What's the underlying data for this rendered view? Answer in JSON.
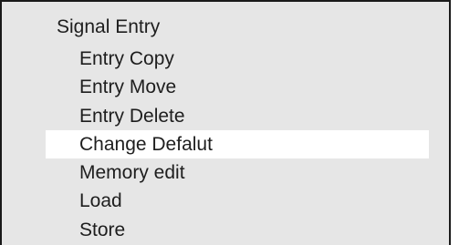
{
  "menu": {
    "title": "Signal Entry",
    "items": [
      {
        "label": "Entry Copy",
        "selected": false
      },
      {
        "label": "Entry Move",
        "selected": false
      },
      {
        "label": "Entry Delete",
        "selected": false
      },
      {
        "label": "Change Defalut",
        "selected": true
      },
      {
        "label": "Memory edit",
        "selected": false
      },
      {
        "label": "Load",
        "selected": false
      },
      {
        "label": "Store",
        "selected": false
      }
    ]
  }
}
